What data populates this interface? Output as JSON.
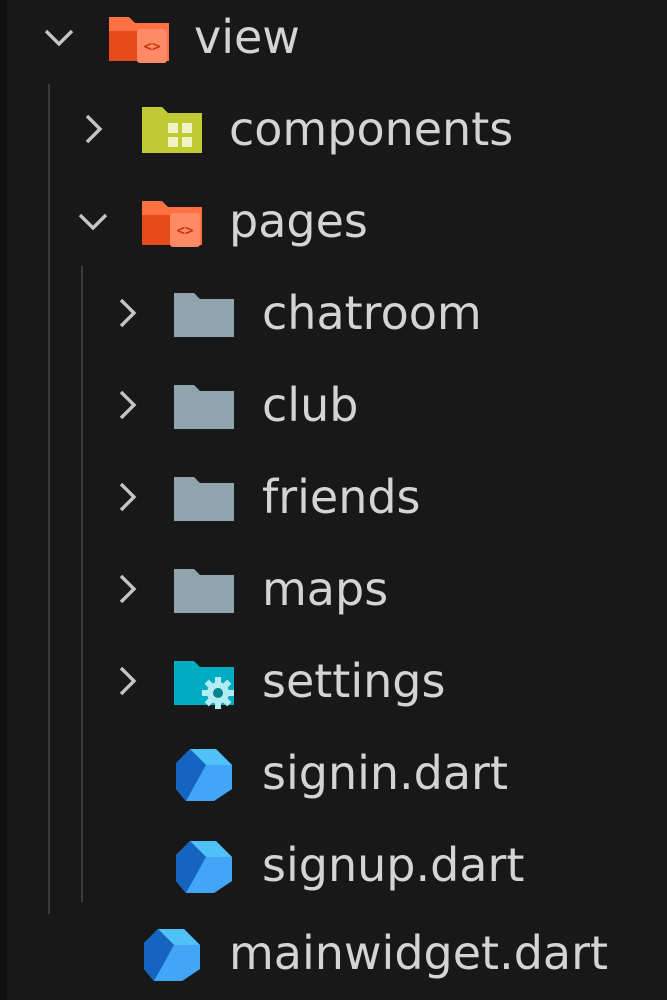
{
  "tree": {
    "root": {
      "label": "view",
      "icon": "folder-view-open-icon",
      "expanded": true
    },
    "components": {
      "label": "components",
      "icon": "folder-components-icon",
      "expanded": false
    },
    "pages": {
      "label": "pages",
      "icon": "folder-view-open-icon",
      "expanded": true
    },
    "children": [
      {
        "label": "chatroom",
        "icon": "folder-icon",
        "expanded": false
      },
      {
        "label": "club",
        "icon": "folder-icon",
        "expanded": false
      },
      {
        "label": "friends",
        "icon": "folder-icon",
        "expanded": false
      },
      {
        "label": "maps",
        "icon": "folder-icon",
        "expanded": false
      },
      {
        "label": "settings",
        "icon": "folder-settings-icon",
        "expanded": false
      },
      {
        "label": "signin.dart",
        "icon": "dart-file-icon"
      },
      {
        "label": "signup.dart",
        "icon": "dart-file-icon"
      }
    ],
    "mainwidget": {
      "label": "mainwidget.dart",
      "icon": "dart-file-icon"
    }
  },
  "colors": {
    "background": "#181818",
    "text": "#d4d4d4",
    "chevron": "#c5c5c5",
    "folder_view": "#ff7043",
    "folder_components": "#c0ca33",
    "folder_plain": "#90a4ae",
    "folder_settings": "#00acc1",
    "dart": "#42a5f5"
  }
}
